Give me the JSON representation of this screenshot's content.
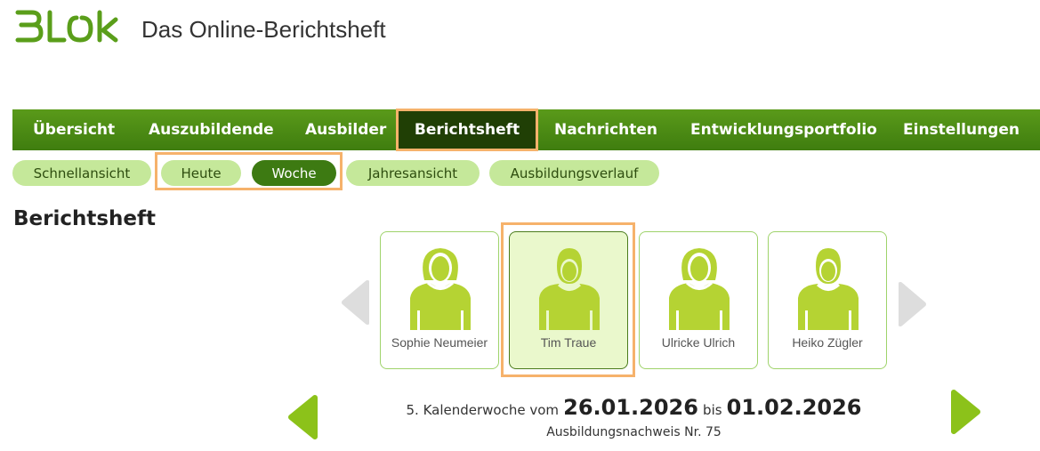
{
  "header": {
    "logo_text": "BLok",
    "app_title": "Das Online-Berichtsheft"
  },
  "main_nav": {
    "items": [
      {
        "label": "Übersicht"
      },
      {
        "label": "Auszubildende"
      },
      {
        "label": "Ausbilder"
      },
      {
        "label": "Berichtsheft",
        "active": true
      },
      {
        "label": "Nachrichten"
      },
      {
        "label": "Entwicklungsportfolio"
      },
      {
        "label": "Einstellungen"
      }
    ]
  },
  "sub_nav": {
    "items": [
      {
        "label": "Schnellansicht"
      },
      {
        "label": "Heute"
      },
      {
        "label": "Woche",
        "active": true
      },
      {
        "label": "Jahresansicht"
      },
      {
        "label": "Ausbildungsverlauf"
      }
    ]
  },
  "page_title": "Berichtsheft",
  "trainees": [
    {
      "name": "Sophie Neumeier",
      "avatar": "female-avatar-icon"
    },
    {
      "name": "Tim Traue",
      "avatar": "male-avatar-icon",
      "selected": true
    },
    {
      "name": "Ulricke Ulrich",
      "avatar": "female-avatar-icon"
    },
    {
      "name": "Heiko Zügler",
      "avatar": "male-avatar-icon"
    }
  ],
  "week": {
    "prefix": "5. Kalenderwoche vom",
    "from": "26.01.2026",
    "connector": "bis",
    "to": "01.02.2026",
    "report_number": "Ausbildungsnachweis Nr. 75"
  },
  "colors": {
    "brand_green": "#4e8b1a",
    "nav_active": "#203f05",
    "pill": "#c5e89a",
    "pill_active": "#3d7a12",
    "avatar": "#b5d333",
    "highlight": "#f6b26b",
    "arrow_green": "#8cc21a",
    "arrow_grey": "#dddddd"
  }
}
